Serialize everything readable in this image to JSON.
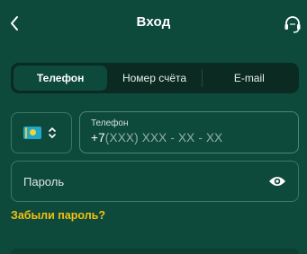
{
  "header": {
    "title": "Вход",
    "back_icon": "chevron-left-icon",
    "support_icon": "headset-icon"
  },
  "tabs": [
    {
      "label": "Телефон",
      "active": true
    },
    {
      "label": "Номер счёта",
      "active": false
    },
    {
      "label": "E-mail",
      "active": false
    }
  ],
  "country": {
    "flag_icon": "kazakhstan-flag-icon",
    "chevron_icon": "chevron-up-down-icon"
  },
  "phone": {
    "label": "Телефон",
    "prefix": "+7",
    "mask": "(XXX) XXX - XX - XX"
  },
  "password": {
    "placeholder": "Пароль",
    "toggle_icon": "eye-icon"
  },
  "forgot": {
    "label": "Забыли пароль?"
  },
  "colors": {
    "background": "#0e4a3c",
    "tab_track": "#0a2a22",
    "accent": "#f2c10f",
    "border": "#3d7566"
  }
}
